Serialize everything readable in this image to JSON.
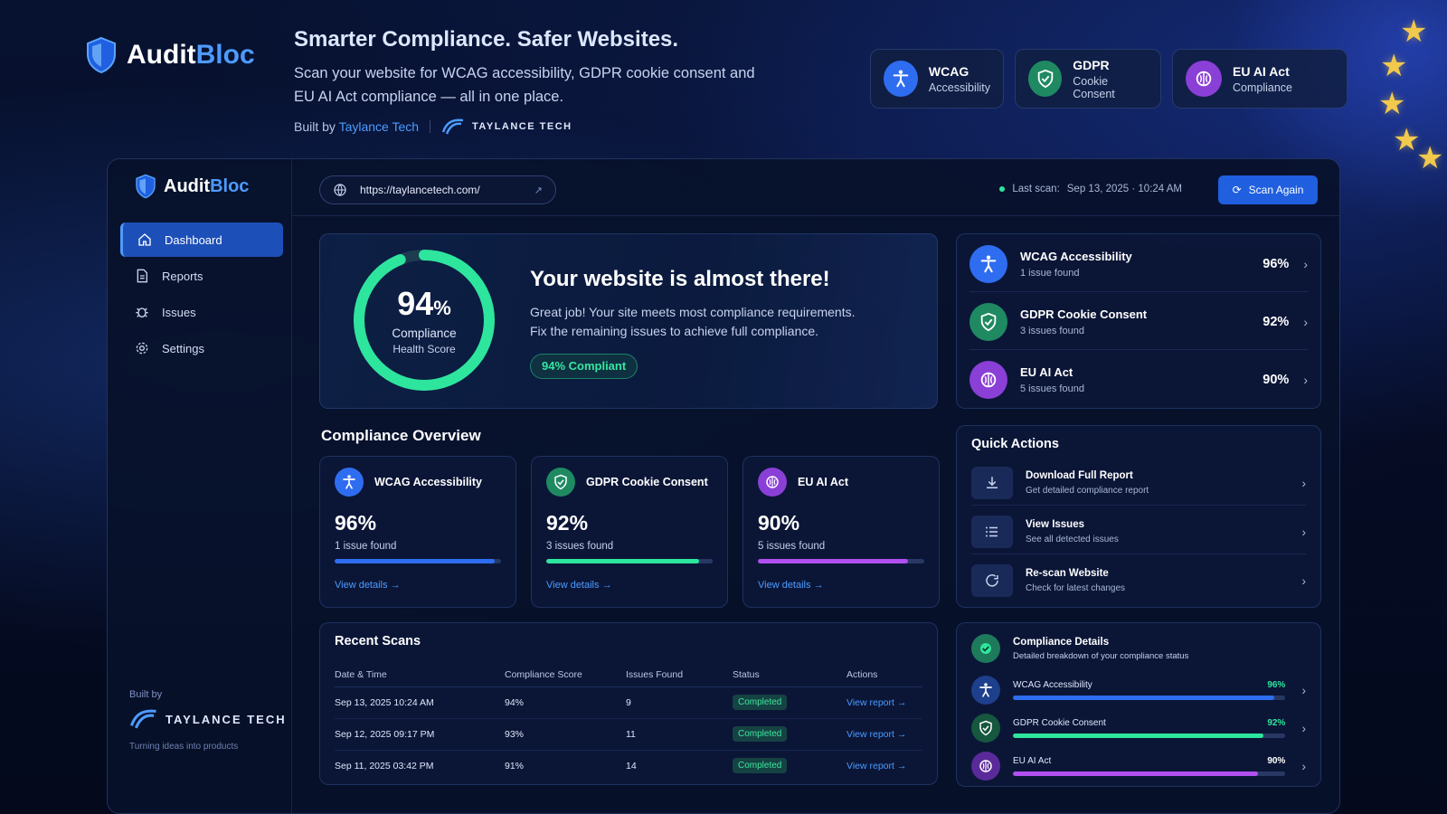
{
  "brand": {
    "name_part1": "Audit",
    "name_part2": "Bloc"
  },
  "hero": {
    "headline": "Smarter Compliance. Safer Websites.",
    "description": "Scan your website for WCAG accessibility, GDPR cookie consent and EU AI Act compliance — all in one place.",
    "built_by_prefix": "Built by",
    "built_by_link": "Taylance Tech",
    "partner_logo_text": "TAYLANCE TECH"
  },
  "header_badges": [
    {
      "title": "WCAG",
      "subtitle": "Accessibility",
      "icon": "accessibility-icon",
      "color": "#2f6df0"
    },
    {
      "title": "GDPR",
      "subtitle": "Cookie Consent",
      "icon": "shield-check-icon",
      "color": "#1f8a62"
    },
    {
      "title": "EU AI Act",
      "subtitle": "Compliance",
      "icon": "brain-icon",
      "color": "#8a3fd6"
    }
  ],
  "sidebar": {
    "items": [
      {
        "label": "Dashboard",
        "icon": "home-icon",
        "active": true
      },
      {
        "label": "Reports",
        "icon": "document-icon"
      },
      {
        "label": "Issues",
        "icon": "bug-icon"
      },
      {
        "label": "Settings",
        "icon": "gear-icon"
      }
    ],
    "footer": {
      "built_by": "Built by",
      "logo_text": "TAYLANCE TECH",
      "tagline": "Turning ideas into products"
    }
  },
  "topbar": {
    "url": "https://taylancetech.com/",
    "last_scan_label": "Last scan:",
    "last_scan_value": "Sep 13, 2025 · 10:24 AM",
    "scan_button": "Scan Again"
  },
  "score": {
    "value": "94",
    "percent_sign": "%",
    "fraction": 0.94,
    "label1": "Compliance",
    "label2": "Health Score",
    "headline": "Your website is almost there!",
    "line1": "Great job! Your site meets most compliance requirements.",
    "line2": "Fix the remaining issues to achieve full compliance.",
    "pill": "94%  Compliant"
  },
  "modules": [
    {
      "title": "WCAG Accessibility",
      "issues": "1 issue found",
      "value": "96%",
      "icon": "accessibility-icon",
      "color": "#2f6df0"
    },
    {
      "title": "GDPR Cookie Consent",
      "issues": "3 issues found",
      "value": "92%",
      "icon": "shield-check-icon",
      "color": "#1f8a62"
    },
    {
      "title": "EU AI Act",
      "issues": "5 issues found",
      "value": "90%",
      "icon": "brain-icon",
      "color": "#8a3fd6"
    }
  ],
  "overview": {
    "title": "Compliance Overview",
    "cards": [
      {
        "title": "WCAG Accessibility",
        "value": "96%",
        "fraction": 0.96,
        "issues": "1 issue found",
        "link": "View details",
        "color": "#2f6df0"
      },
      {
        "title": "GDPR Cookie Consent",
        "value": "92%",
        "fraction": 0.92,
        "issues": "3 issues found",
        "link": "View details",
        "color": "#2ee59d"
      },
      {
        "title": "EU AI Act",
        "value": "90%",
        "fraction": 0.9,
        "issues": "5 issues found",
        "link": "View details",
        "color": "#b14ff0"
      }
    ]
  },
  "quick_actions": {
    "title": "Quick Actions",
    "items": [
      {
        "title": "Download Full Report",
        "subtitle": "Get detailed compliance report",
        "icon": "download-icon"
      },
      {
        "title": "View Issues",
        "subtitle": "See all detected issues",
        "icon": "list-icon"
      },
      {
        "title": "Re-scan Website",
        "subtitle": "Check for latest changes",
        "icon": "refresh-icon"
      }
    ]
  },
  "recent_scans": {
    "title": "Recent Scans",
    "columns": [
      "Date & Time",
      "Compliance Score",
      "Issues Found",
      "Status",
      "Actions"
    ],
    "rows": [
      {
        "date": "Sep 13, 2025 10:24 AM",
        "score": "94%",
        "issues": "9",
        "status": "Completed",
        "action": "View report"
      },
      {
        "date": "Sep 12, 2025 09:17 PM",
        "score": "93%",
        "issues": "11",
        "status": "Completed",
        "action": "View report"
      },
      {
        "date": "Sep 11, 2025 03:42 PM",
        "score": "91%",
        "issues": "14",
        "status": "Completed",
        "action": "View report"
      }
    ]
  },
  "compliance_details": {
    "title": "Compliance Details",
    "subtitle": "Detailed breakdown of your compliance status",
    "items": [
      {
        "label": "WCAG Accessibility",
        "value": "96%",
        "fraction": 0.96,
        "color": "#2f6df0",
        "pct_color": "#2ee59d"
      },
      {
        "label": "GDPR Cookie Consent",
        "value": "92%",
        "fraction": 0.92,
        "color": "#2ee59d",
        "pct_color": "#2ee59d"
      },
      {
        "label": "EU AI Act",
        "value": "90%",
        "fraction": 0.9,
        "color": "#b14ff0",
        "pct_color": "#ffffff"
      }
    ]
  }
}
